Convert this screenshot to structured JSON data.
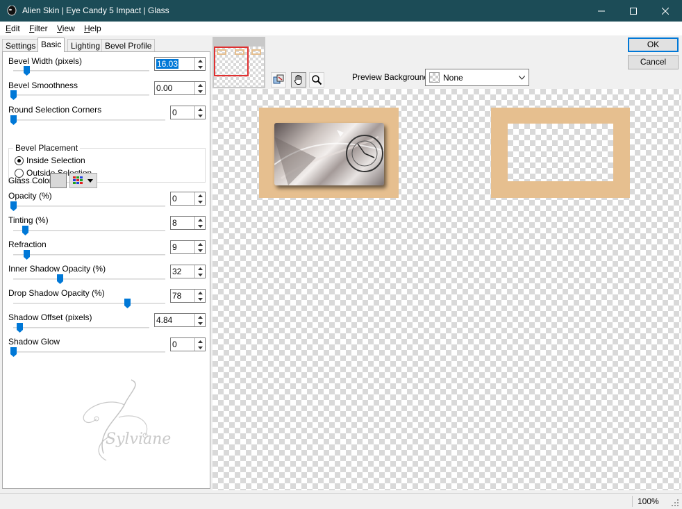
{
  "window": {
    "title": "Alien Skin | Eye Candy 5 Impact | Glass",
    "titlebar_color": "#1c4c57"
  },
  "menu": [
    {
      "label": "Edit",
      "key": "E",
      "rest": "dit"
    },
    {
      "label": "Filter",
      "key": "F",
      "rest": "ilter"
    },
    {
      "label": "View",
      "key": "V",
      "rest": "iew"
    },
    {
      "label": "Help",
      "key": "H",
      "rest": "elp"
    }
  ],
  "tabs": [
    "Settings",
    "Basic",
    "Lighting",
    "Bevel Profile"
  ],
  "active_tab": "Basic",
  "controls": {
    "bevel_width": {
      "label": "Bevel Width (pixels)",
      "value": "16.03",
      "level": 0.1
    },
    "bevel_smoothness": {
      "label": "Bevel Smoothness",
      "value": "0.00",
      "level": 0.0
    },
    "round_corners": {
      "label": "Round Selection Corners",
      "value": "0",
      "level": 0.0
    },
    "bevel_placement": {
      "title": "Bevel Placement",
      "options": [
        "Inside Selection",
        "Outside Selection"
      ],
      "selected": "Inside Selection"
    },
    "glass_color": {
      "label": "Glass Color",
      "swatch": "#d8d8d8"
    },
    "opacity": {
      "label": "Opacity (%)",
      "value": "0",
      "level": 0.0
    },
    "tinting": {
      "label": "Tinting (%)",
      "value": "8",
      "level": 0.08
    },
    "refraction": {
      "label": "Refraction",
      "value": "9",
      "level": 0.09
    },
    "inner_shadow_opacity": {
      "label": "Inner Shadow Opacity (%)",
      "value": "32",
      "level": 0.32
    },
    "drop_shadow_opacity": {
      "label": "Drop Shadow Opacity (%)",
      "value": "78",
      "level": 0.78
    },
    "shadow_offset": {
      "label": "Shadow Offset (pixels)",
      "value": "4.84",
      "level": 0.05
    },
    "shadow_glow": {
      "label": "Shadow Glow",
      "value": "0",
      "level": 0.0
    }
  },
  "watermark": "Sylviane",
  "buttons": {
    "ok": "OK",
    "cancel": "Cancel"
  },
  "preview_background": {
    "label": "Preview Background:",
    "value": "None"
  },
  "accent_color": "#0078d7",
  "frame_color": "#e6bf8f",
  "status": {
    "zoom": "100%"
  }
}
